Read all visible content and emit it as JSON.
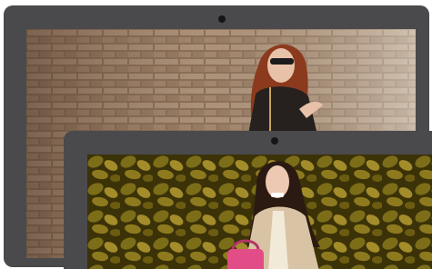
{
  "showcase": {
    "back_device": {
      "type": "laptop-style frame",
      "screen_image": "woman-with-sunglasses-against-brick-wall-photo",
      "frame_color": "#4a4a4c"
    },
    "front_device": {
      "type": "laptop-style frame",
      "screen_image": "woman-with-pink-handbag-in-ivy-photo",
      "frame_color": "#4a4a4c"
    },
    "colors": {
      "frame": "#4a4a4c",
      "camera": "#151515",
      "brick": "#a98d74",
      "ivy": "#7c6d18",
      "handbag": "#e24d87"
    }
  }
}
